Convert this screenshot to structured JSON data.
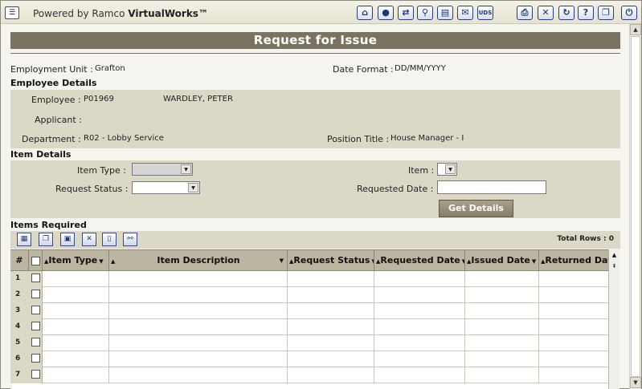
{
  "topbar": {
    "menu_icon": "menu-icon",
    "brand_prefix": "Powered by Ramco ",
    "brand_name": "VirtualWorks™",
    "icons_left": [
      "home-icon",
      "user-icon",
      "transfer-icon",
      "search-user-icon",
      "document-icon",
      "mail-icon",
      "uds-icon"
    ],
    "uds_label": "UDS",
    "icons_right": [
      "print-icon",
      "close-icon",
      "refresh-icon",
      "help-icon",
      "copy-icon",
      "exit-icon"
    ]
  },
  "page": {
    "title": "Request for Issue"
  },
  "header": {
    "employment_unit_label": "Employment Unit :",
    "employment_unit_value": "Grafton",
    "date_format_label": "Date Format :",
    "date_format_value": "DD/MM/YYYY"
  },
  "employee_details": {
    "heading": "Employee Details",
    "employee_label": "Employee :",
    "employee_code": "P01969",
    "employee_name": "WARDLEY, PETER",
    "applicant_label": "Applicant :",
    "department_label": "Department :",
    "department_value": "R02 - Lobby Service",
    "position_label": "Position Title :",
    "position_value": "House Manager - I"
  },
  "item_details": {
    "heading": "Item Details",
    "item_type_label": "Item Type :",
    "item_label": "Item :",
    "request_status_label": "Request Status :",
    "requested_date_label": "Requested Date :",
    "get_details_label": "Get Details"
  },
  "items_required": {
    "heading": "Items Required",
    "toolbar_icons": [
      "add-row-icon",
      "copy-row-icon",
      "save-icon",
      "excel-icon",
      "view-icon",
      "find-icon"
    ],
    "total_rows_label": "Total Rows :",
    "total_rows_value": "0",
    "columns": [
      "#",
      "Item Type",
      "Item Description",
      "Request Status",
      "Requested Date",
      "Issued Date",
      "Returned Date"
    ],
    "row_numbers": [
      "1",
      "2",
      "3",
      "4",
      "5",
      "6",
      "7"
    ]
  }
}
